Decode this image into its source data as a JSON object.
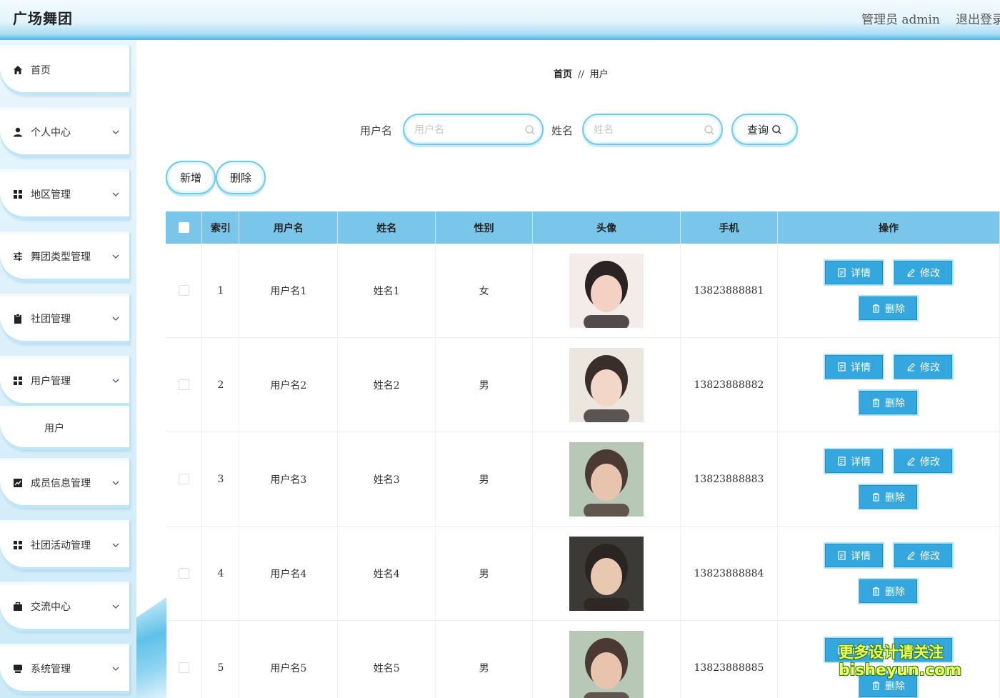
{
  "header": {
    "title": "广场舞团",
    "admin_label": "管理员 admin",
    "logout_label": "退出登录"
  },
  "sidebar": {
    "items": [
      {
        "label": "首页",
        "icon": "home-icon"
      },
      {
        "label": "个人中心",
        "icon": "user-icon"
      },
      {
        "label": "地区管理",
        "icon": "grid-icon"
      },
      {
        "label": "舞团类型管理",
        "icon": "sliders-icon"
      },
      {
        "label": "社团管理",
        "icon": "clipboard-icon"
      },
      {
        "label": "用户管理",
        "icon": "grid-icon"
      },
      {
        "label": "用户",
        "icon": ""
      },
      {
        "label": "成员信息管理",
        "icon": "chart-icon"
      },
      {
        "label": "社团活动管理",
        "icon": "grid-icon"
      },
      {
        "label": "交流中心",
        "icon": "briefcase-icon"
      },
      {
        "label": "系统管理",
        "icon": "chat-icon"
      }
    ]
  },
  "breadcrumb": {
    "home": "首页",
    "separator": "//",
    "current": "用户"
  },
  "search": {
    "username_label": "用户名",
    "username_placeholder": "用户名",
    "name_label": "姓名",
    "name_placeholder": "姓名",
    "query_label": "查询"
  },
  "actions": {
    "add_label": "新增",
    "delete_label": "删除"
  },
  "table": {
    "headers": [
      "索引",
      "用户名",
      "姓名",
      "性别",
      "头像",
      "手机",
      "操作"
    ],
    "rows": [
      {
        "index": "1",
        "username": "用户名1",
        "name": "姓名1",
        "gender": "女",
        "phone": "13823888881"
      },
      {
        "index": "2",
        "username": "用户名2",
        "name": "姓名2",
        "gender": "男",
        "phone": "13823888882"
      },
      {
        "index": "3",
        "username": "用户名3",
        "name": "姓名3",
        "gender": "男",
        "phone": "13823888883"
      },
      {
        "index": "4",
        "username": "用户名4",
        "name": "姓名4",
        "gender": "男",
        "phone": "13823888884"
      },
      {
        "index": "5",
        "username": "用户名5",
        "name": "姓名5",
        "gender": "男",
        "phone": "13823888885"
      }
    ],
    "row_actions": {
      "detail": "详情",
      "edit": "修改",
      "delete": "删除"
    }
  },
  "watermark": {
    "line1": "更多设计请关注",
    "line2": "bisheyun.com"
  },
  "colors": {
    "accent": "#33a7de",
    "header_bg": "#7ac6ea",
    "border": "#6ecbeb"
  }
}
